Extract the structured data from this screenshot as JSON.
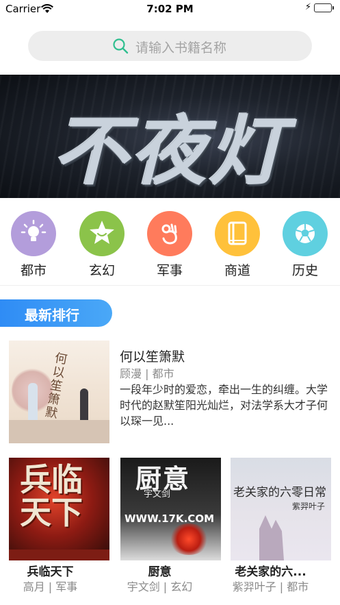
{
  "status_bar": {
    "carrier": "Carrier",
    "time": "7:02 PM"
  },
  "search": {
    "placeholder": "请输入书籍名称"
  },
  "banner": {
    "title_art": "不夜灯"
  },
  "categories": [
    {
      "label": "都市",
      "icon": "lightbulb-icon",
      "color": "#b39ddb"
    },
    {
      "label": "玄幻",
      "icon": "star-smile-icon",
      "color": "#8bc34a"
    },
    {
      "label": "军事",
      "icon": "hand-ok-icon",
      "color": "#ff7b5c"
    },
    {
      "label": "商道",
      "icon": "book-icon",
      "color": "#ffc13b"
    },
    {
      "label": "历史",
      "icon": "soccer-ball-icon",
      "color": "#5fd0e0"
    }
  ],
  "section": {
    "title": "最新排行",
    "accent": "#2f8cf5"
  },
  "featured": {
    "title": "何以笙箫默",
    "author": "顾漫",
    "category": "都市",
    "description": "一段年少时的爱恋，牵出一生的纠缠。大学时代的赵默笙阳光灿烂，对法学系大才子何以琛一见...",
    "cover_text": "何以笙箫默"
  },
  "grid": [
    {
      "title": "兵临天下",
      "author": "高月",
      "category": "军事",
      "cover_text": "兵临天下"
    },
    {
      "title": "厨意",
      "author": "宇文剑",
      "category": "玄幻",
      "cover_text": "厨意",
      "cover_author": "宇文剑",
      "cover_site": "WWW.17K.COM"
    },
    {
      "title": "老关家的六...",
      "author": "紫羿叶子",
      "category": "都市",
      "cover_text": "老关家的六零日常",
      "cover_author": "紫羿叶子"
    }
  ]
}
